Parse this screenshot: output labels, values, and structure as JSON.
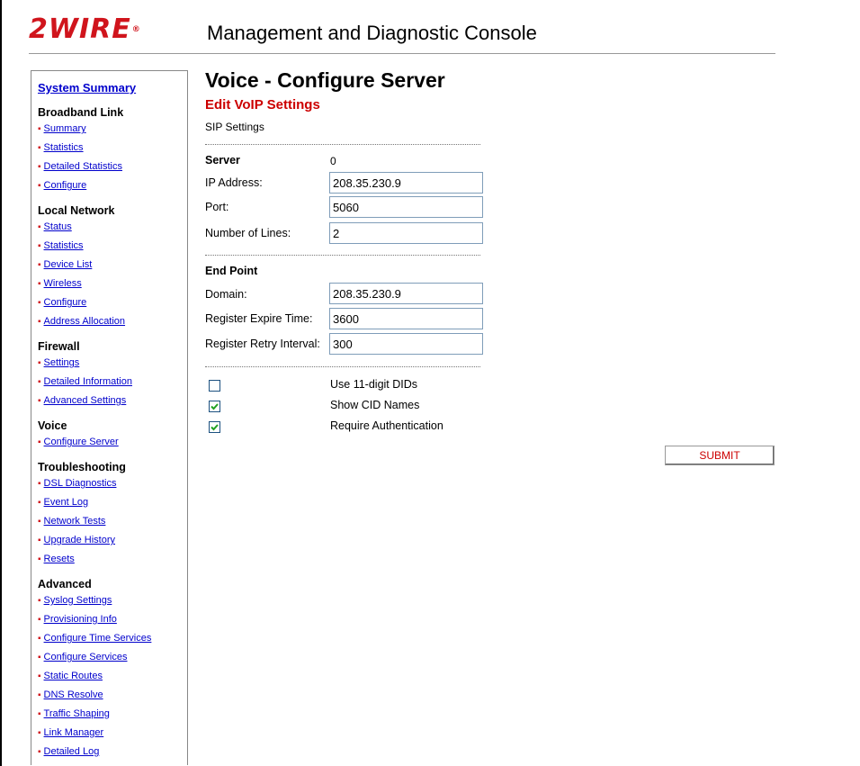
{
  "header": {
    "logo_text": "2WIRE",
    "logo_mark": "®",
    "console_title": "Management and Diagnostic Console"
  },
  "sidebar": {
    "summary": "System Summary",
    "sections": [
      {
        "title": "Broadband Link",
        "links": [
          "Summary",
          "Statistics",
          "Detailed Statistics",
          "Configure"
        ]
      },
      {
        "title": "Local Network",
        "links": [
          "Status",
          "Statistics",
          "Device List",
          "Wireless",
          "Configure",
          "Address Allocation"
        ]
      },
      {
        "title": "Firewall",
        "links": [
          "Settings",
          "Detailed Information",
          "Advanced Settings"
        ]
      },
      {
        "title": "Voice",
        "links": [
          "Configure Server"
        ]
      },
      {
        "title": "Troubleshooting",
        "links": [
          "DSL Diagnostics",
          "Event Log",
          "Network Tests",
          "Upgrade History",
          "Resets"
        ]
      },
      {
        "title": "Advanced",
        "links": [
          "Syslog Settings",
          "Provisioning Info",
          "Configure Time Services",
          "Configure Services",
          "Static Routes",
          "DNS Resolve",
          "Traffic Shaping",
          "Link Manager",
          "Detailed Log"
        ]
      }
    ]
  },
  "main": {
    "page_title": "Voice - Configure Server",
    "subtitle": "Edit VoIP Settings",
    "sip_label": "SIP Settings",
    "server": {
      "heading": "Server",
      "value": "0",
      "ip_label": "IP Address:",
      "ip_value": "208.35.230.9",
      "port_label": "Port:",
      "port_value": "5060",
      "lines_label": "Number of Lines:",
      "lines_value": "2"
    },
    "endpoint": {
      "heading": "End Point",
      "domain_label": "Domain:",
      "domain_value": "208.35.230.9",
      "expire_label": "Register Expire Time:",
      "expire_value": "3600",
      "retry_label": "Register Retry Interval:",
      "retry_value": "300"
    },
    "options": [
      {
        "label": "Use 11-digit DIDs",
        "checked": false
      },
      {
        "label": "Show CID Names",
        "checked": true
      },
      {
        "label": "Require Authentication",
        "checked": true
      }
    ],
    "submit_label": "SUBMIT"
  },
  "colors": {
    "brand_red": "#d0141c",
    "link_blue": "#0000cc"
  }
}
